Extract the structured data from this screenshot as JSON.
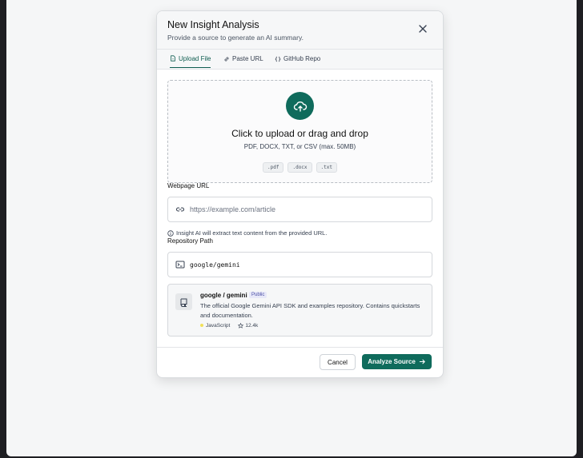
{
  "modal": {
    "title": "New Insight Analysis",
    "subtitle": "Provide a source to generate an AI summary."
  },
  "tabs": [
    {
      "label": "Upload File",
      "icon": "file-icon",
      "active": true
    },
    {
      "label": "Paste URL",
      "icon": "link-icon",
      "active": false
    },
    {
      "label": "GitHub Repo",
      "icon": "code-braces-icon",
      "active": false
    }
  ],
  "upload": {
    "title": "Click to upload or drag and drop",
    "subtitle": "PDF, DOCX, TXT, or CSV (max. 50MB)",
    "chips": [
      ".pdf",
      ".docx",
      ".txt"
    ]
  },
  "url": {
    "label": "Webpage URL",
    "placeholder": "https://example.com/article",
    "hint": "Insight AI will extract text content from the provided URL."
  },
  "repo": {
    "label": "Repository Path",
    "value": "google/gemini",
    "card": {
      "name": "google / gemini",
      "badge": "Public",
      "description": "The official Google Gemini API SDK and examples repository. Contains quickstarts and documentation.",
      "language": "JavaScript",
      "language_color": "#f1e05a",
      "stars": "12.4k"
    }
  },
  "footer": {
    "cancel": "Cancel",
    "submit": "Analyze Source"
  },
  "colors": {
    "accent": "#0f6b5c"
  }
}
